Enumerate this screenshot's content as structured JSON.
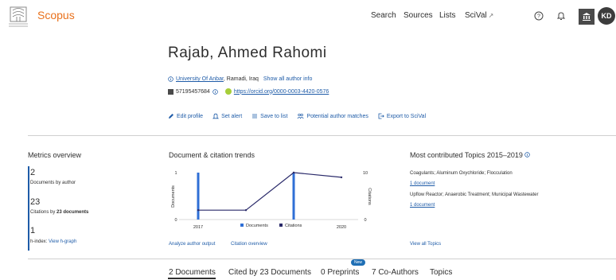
{
  "header": {
    "brand": "Scopus",
    "nav": {
      "search": "Search",
      "sources": "Sources",
      "lists": "Lists",
      "scival": "SciVal",
      "scival_ext": "↗"
    },
    "avatar_initials": "KD"
  },
  "author": {
    "name": "Rajab, Ahmed Rahomi",
    "affiliation": "University Of Anbar",
    "location": ", Ramadi, Iraq",
    "show_all": "Show all author info",
    "author_id": "57195457684",
    "orcid": "https://orcid.org/0000-0003-4420-0576"
  },
  "actions": {
    "edit_profile": "Edit profile",
    "set_alert": "Set alert",
    "save_to_list": "Save to list",
    "potential_matches": "Potential author matches",
    "export_scival": "Export to SciVal"
  },
  "metrics": {
    "title": "Metrics overview",
    "documents_value": "2",
    "documents_label": "Documents by author",
    "citations_value": "23",
    "citations_label_prefix": "Citations by ",
    "citations_label_bold": "23 documents",
    "hindex_value": "1",
    "hindex_label": "h-index:",
    "hindex_link": "View h-graph"
  },
  "trends": {
    "title": "Document & citation trends",
    "analyze_link": "Analyze author output",
    "citation_link": "Citation overview"
  },
  "chart_data": {
    "type": "bar",
    "x_ticks": [
      "2017",
      "2020"
    ],
    "xlim": [
      2017,
      2020
    ],
    "y_left_label": "Documents",
    "y_left_ticks": [
      "0",
      "1"
    ],
    "y_right_label": "Citations",
    "y_right_ticks": [
      "0",
      "10"
    ],
    "series": [
      {
        "name": "Documents",
        "type": "bar",
        "axis": "left",
        "x": [
          2017,
          2019
        ],
        "values": [
          1,
          1
        ],
        "color": "#2f6fd6"
      },
      {
        "name": "Citations",
        "type": "line",
        "axis": "right",
        "x": [
          2017,
          2018,
          2019,
          2020
        ],
        "values": [
          2,
          2,
          10,
          9
        ],
        "color": "#2a2a6a"
      }
    ],
    "legend_position": "bottom"
  },
  "topics": {
    "title": "Most contributed Topics 2015–2019",
    "items": [
      {
        "name": "Coagulants; Aluminum Oxychloride; Flocculation",
        "docs": "1 document"
      },
      {
        "name": "Upflow Reactor; Anaerobic Treatment; Municipal Wastewater",
        "docs": "1 document"
      }
    ],
    "view_all": "View all Topics"
  },
  "tabs": {
    "documents": "2 Documents",
    "cited_by": "Cited by 23 Documents",
    "preprints": "0 Preprints",
    "new_badge": "New",
    "coauthors": "7 Co-Authors",
    "topics": "Topics"
  }
}
